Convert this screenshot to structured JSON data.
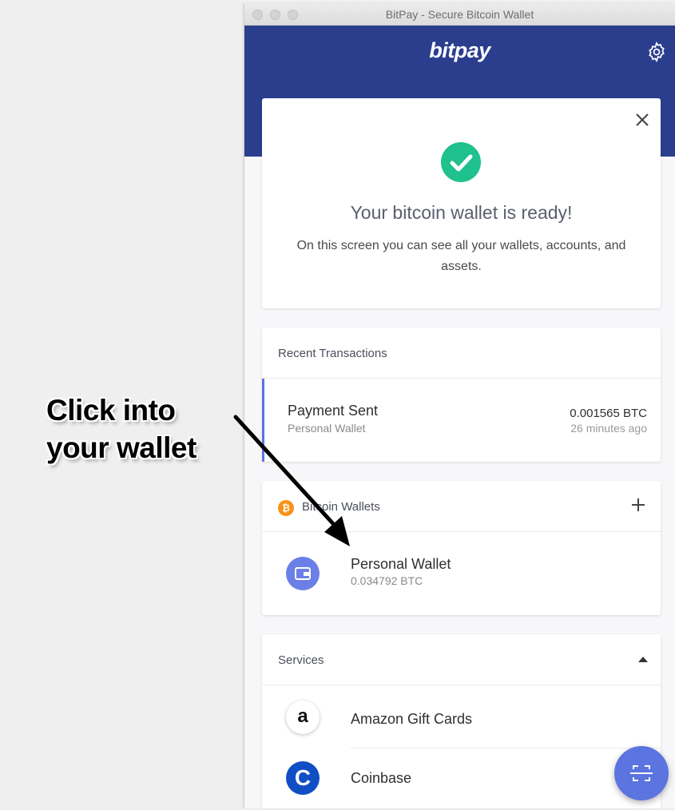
{
  "window": {
    "title": "BitPay - Secure Bitcoin Wallet"
  },
  "header": {
    "logo": "bitpay",
    "settings_icon": "gear-icon"
  },
  "welcome_card": {
    "title": "Your bitcoin wallet is ready!",
    "body": "On this screen you can see all your wallets, accounts, and assets.",
    "close_icon": "close-icon",
    "status_icon": "check-circle-icon",
    "status_color": "#1fc18d"
  },
  "recent_transactions": {
    "label": "Recent Transactions",
    "items": [
      {
        "title": "Payment Sent",
        "wallet": "Personal Wallet",
        "amount": "0.001565 BTC",
        "time": "26 minutes ago"
      }
    ]
  },
  "bitcoin_wallets": {
    "label": "Bitcoin Wallets",
    "add_icon": "plus-icon",
    "items": [
      {
        "name": "Personal Wallet",
        "balance": "0.034792 BTC"
      }
    ]
  },
  "services": {
    "label": "Services",
    "items": [
      {
        "name": "Amazon Gift Cards",
        "icon_glyph": "a"
      },
      {
        "name": "Coinbase",
        "icon_glyph": "C"
      }
    ]
  },
  "fab": {
    "icon": "scan-icon"
  },
  "annotation": {
    "line1": "Click into",
    "line2": "your wallet"
  },
  "colors": {
    "brand": "#2b3e8e",
    "accent": "#5b74e0",
    "bitcoin": "#f7931a"
  }
}
